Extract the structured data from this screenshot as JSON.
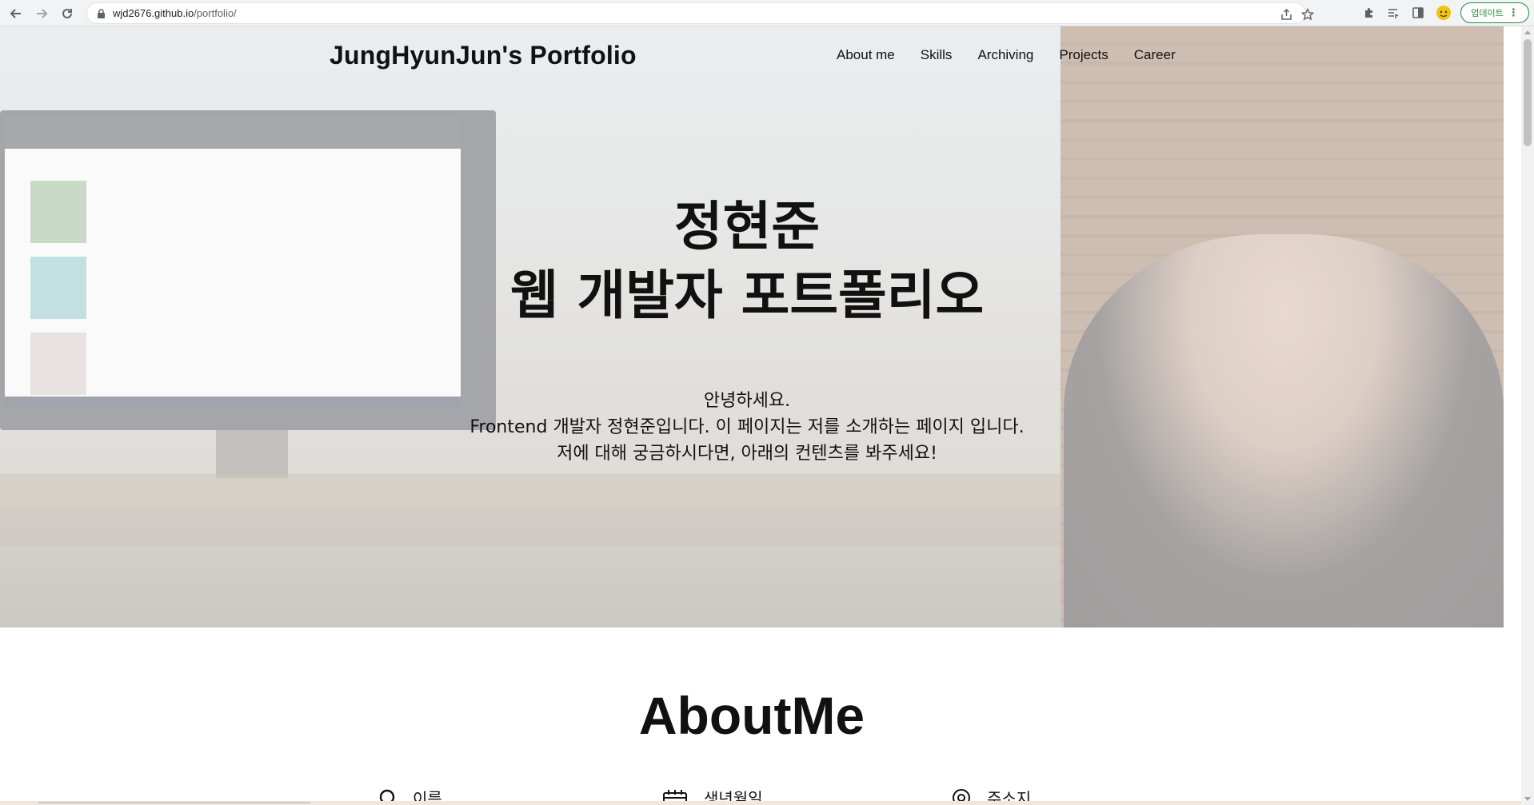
{
  "browser": {
    "url_host": "wjd2676.github.io",
    "url_path": "/portfolio/",
    "update_label": "업데이트",
    "back_icon": "arrow-left-icon",
    "forward_icon": "arrow-right-icon",
    "reload_icon": "reload-icon"
  },
  "header": {
    "title": "JungHyunJun's Portfolio",
    "nav": [
      "About me",
      "Skills",
      "Archiving",
      "Projects",
      "Career"
    ]
  },
  "hero": {
    "heading_line1": "정현준",
    "heading_line2": "웹 개발자 포트폴리오",
    "intro_line1": "안녕하세요.",
    "intro_line2": "Frontend 개발자 정현준입니다. 이 페이지는 저를 소개하는 페이지 입니다.",
    "intro_line3": "저에 대해 궁금하시다면, 아래의 컨텐츠를 봐주세요!"
  },
  "about": {
    "title": "AboutMe",
    "items": [
      {
        "label": "이름",
        "icon": "person-icon"
      },
      {
        "label": "생년월일",
        "icon": "calendar-icon"
      },
      {
        "label": "주소지",
        "icon": "location-icon"
      }
    ]
  }
}
